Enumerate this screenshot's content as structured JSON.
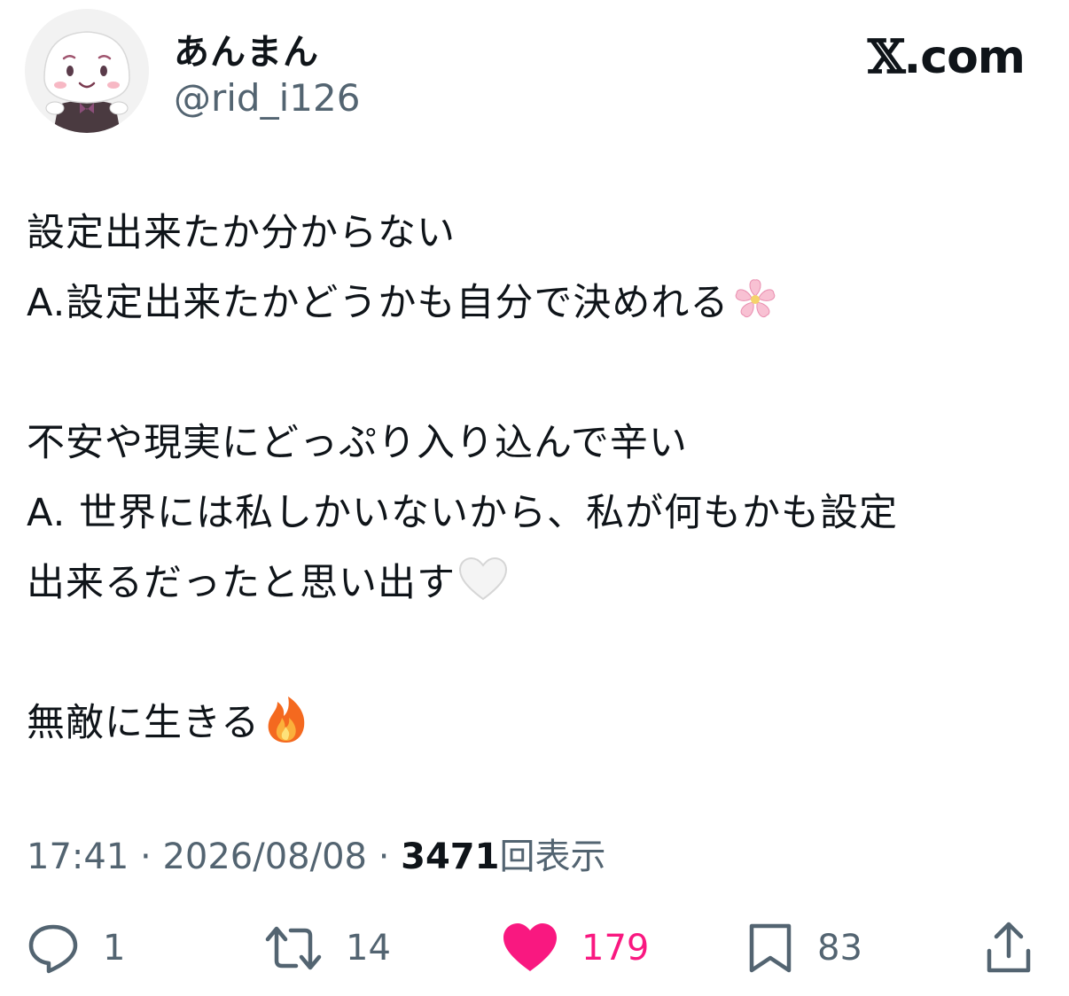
{
  "author": {
    "display_name": "あんまん",
    "handle": "@rid_i126",
    "avatar_icon": "avatar-illustration"
  },
  "brand": {
    "x_letter": "𝕏",
    "suffix": ".com"
  },
  "tweet": {
    "lines": [
      "設定出来たか分からない",
      "A.設定出来たかどうかも自分で決めれる",
      "",
      "不安や現実にどっぷり入り込んで辛い",
      "A. 世界には私しかいないから、私が何もかも設定",
      "出来るだったと思い出す",
      "",
      "無敵に生きる"
    ],
    "emoji_line_2": "cherry-blossom-emoji",
    "emoji_line_6": "white-heart-emoji",
    "emoji_line_8": "fire-emoji"
  },
  "meta": {
    "time": "17:41",
    "separator": "·",
    "date": "2026/08/08",
    "views_count": "3471",
    "views_label": "回表示"
  },
  "actions": {
    "reply_count": "1",
    "retweet_count": "14",
    "like_count": "179",
    "bookmark_count": "83"
  },
  "colors": {
    "like": "#f91880",
    "secondary_text": "#536471",
    "primary_text": "#0f1419"
  }
}
